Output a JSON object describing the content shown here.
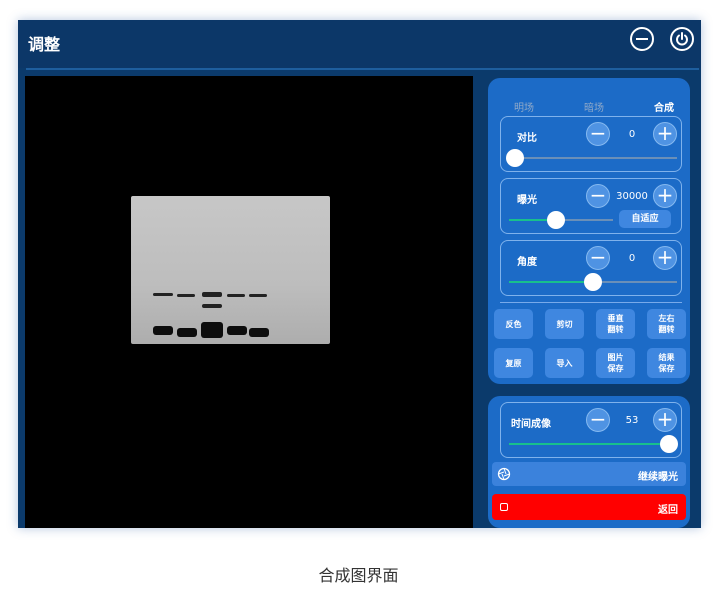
{
  "window": {
    "title": "调整",
    "minus_icon": "minus-circle-icon",
    "power_icon": "power-icon"
  },
  "tabs": [
    {
      "label": "明场",
      "active": false
    },
    {
      "label": "暗场",
      "active": false
    },
    {
      "label": "合成",
      "active": true
    }
  ],
  "contrast": {
    "label": "对比",
    "value": "0",
    "level_fraction": 0.0
  },
  "exposure": {
    "label": "曝光",
    "value": "30000",
    "adaptive_label": "自适应",
    "level_fraction": 0.45
  },
  "angle": {
    "label": "角度",
    "value": "0",
    "level_fraction": 0.5
  },
  "actions": [
    {
      "label": "反色"
    },
    {
      "label": "剪切"
    },
    {
      "label": "垂直\n翻转"
    },
    {
      "label": "左右\n翻转"
    },
    {
      "label": "复原"
    },
    {
      "label": "导入"
    },
    {
      "label": "图片\n保存"
    },
    {
      "label": "结果\n保存"
    }
  ],
  "timelapse": {
    "label": "时间成像",
    "value": "53",
    "level_fraction": 1.0
  },
  "continue": {
    "label": "继续曝光",
    "icon": "aperture-icon"
  },
  "back": {
    "label": "返回",
    "icon": "stop-icon"
  },
  "colors": {
    "frame": "#0b3a6b",
    "panel": "#1c6bc7",
    "accent": "#18c08c",
    "back": "#ff0000"
  },
  "caption": "合成图界面"
}
